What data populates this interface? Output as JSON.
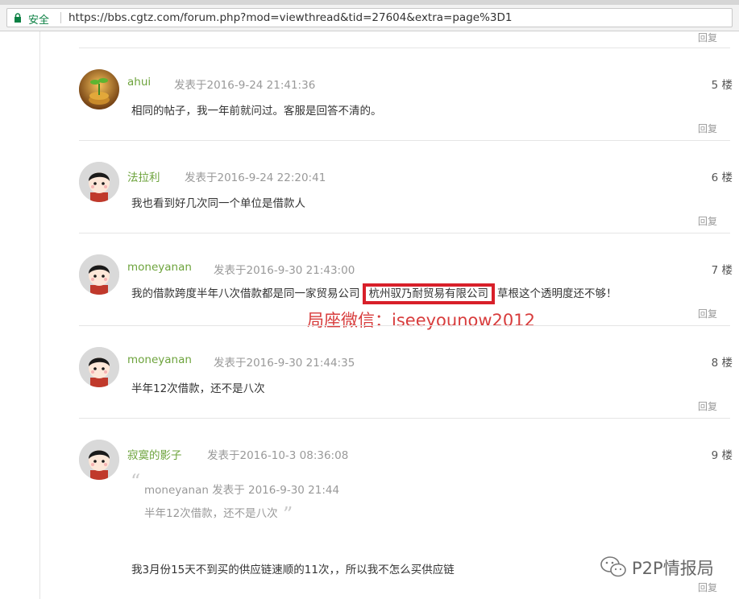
{
  "browser": {
    "security_label": "安全",
    "url": "https://bbs.cgtz.com/forum.php?mod=viewthread&tid=27604&extra=page%3D1"
  },
  "reply_label": "回复",
  "posts": [
    {
      "author": "ahui",
      "date": "发表于2016-9-24 21:41:36",
      "floor": "5 楼",
      "body": "相同的帖子，我一年前就问过。客服是回答不清的。"
    },
    {
      "author": "法拉利",
      "date": "发表于2016-9-24 22:20:41",
      "floor": "6 楼",
      "body": "我也看到好几次同一个单位是借款人"
    },
    {
      "author": "moneyanan",
      "date": "发表于2016-9-30 21:43:00",
      "floor": "7 楼",
      "body_before": "我的借款跨度半年八次借款都是同一家贸易公司",
      "body_highlight": "杭州驭乃耐贸易有限公司",
      "body_after": "草根这个透明度还不够！"
    },
    {
      "author": "moneyanan",
      "date": "发表于2016-9-30 21:44:35",
      "floor": "8 楼",
      "body": "半年12次借款，还不是八次"
    },
    {
      "author": "寂寞的影子",
      "date": "发表于2016-10-3 08:36:08",
      "floor": "9 楼",
      "quote_head": "moneyanan 发表于 2016-9-30 21:44",
      "quote_body": "半年12次借款，还不是八次",
      "body": "我3月份15天不到买的供应链速顺的11次，，所以我不怎么买供应链"
    }
  ],
  "watermark": "局座微信：iseeyounow2012",
  "brand": "P2P情报局",
  "colors": {
    "author": "#6da33c",
    "highlight_border": "#d8202a",
    "watermark": "#d83c3c",
    "secure": "#0b8043"
  }
}
